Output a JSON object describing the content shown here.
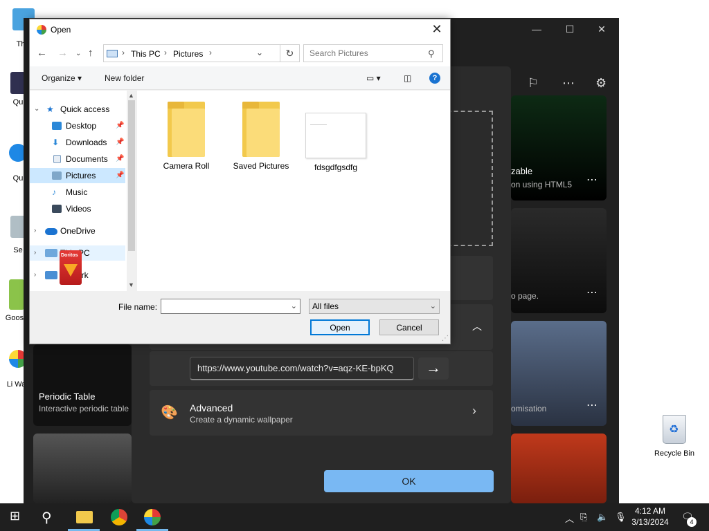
{
  "desktop": {
    "icons": [
      {
        "label": "This"
      },
      {
        "label": "Qu"
      },
      {
        "label": "Qu"
      },
      {
        "label": "Se"
      },
      {
        "label": "Goose"
      },
      {
        "label": "Li Wall"
      }
    ],
    "recycle_bin": "Recycle Bin"
  },
  "app": {
    "cards": [
      {
        "title": "zable",
        "subtitle": "on using HTML5"
      },
      {
        "title": "",
        "subtitle": "o page."
      },
      {
        "title": "",
        "subtitle": "omisation"
      },
      {
        "title": "Periodic Table",
        "subtitle": "Interactive periodic table"
      }
    ],
    "url_value": "https://www.youtube.com/watch?v=aqz-KE-bpKQ",
    "advanced": {
      "title": "Advanced",
      "subtitle": "Create a dynamic wallpaper"
    },
    "ok_label": "OK"
  },
  "dialog": {
    "title": "Open",
    "breadcrumb": [
      "This PC",
      "Pictures"
    ],
    "search_placeholder": "Search Pictures",
    "organize_label": "Organize",
    "new_folder_label": "New folder",
    "help_label": "?",
    "nav_items": [
      {
        "label": "Quick access"
      },
      {
        "label": "Desktop"
      },
      {
        "label": "Downloads"
      },
      {
        "label": "Documents"
      },
      {
        "label": "Pictures"
      },
      {
        "label": "Music"
      },
      {
        "label": "Videos"
      },
      {
        "label": "OneDrive"
      },
      {
        "label": "This PC"
      },
      {
        "label": "ork"
      }
    ],
    "files": [
      {
        "name": "Camera Roll",
        "kind": "folder"
      },
      {
        "name": "Saved Pictures",
        "kind": "folder"
      },
      {
        "name": "fdsgdfgsdfg",
        "kind": "image"
      }
    ],
    "file_name_label": "File name:",
    "file_name_value": "",
    "file_type_value": "All files",
    "open_label": "Open",
    "cancel_label": "Cancel",
    "sticker_text": "Doritos"
  },
  "taskbar": {
    "time": "4:12 AM",
    "date": "3/13/2024",
    "notification_count": "4"
  }
}
